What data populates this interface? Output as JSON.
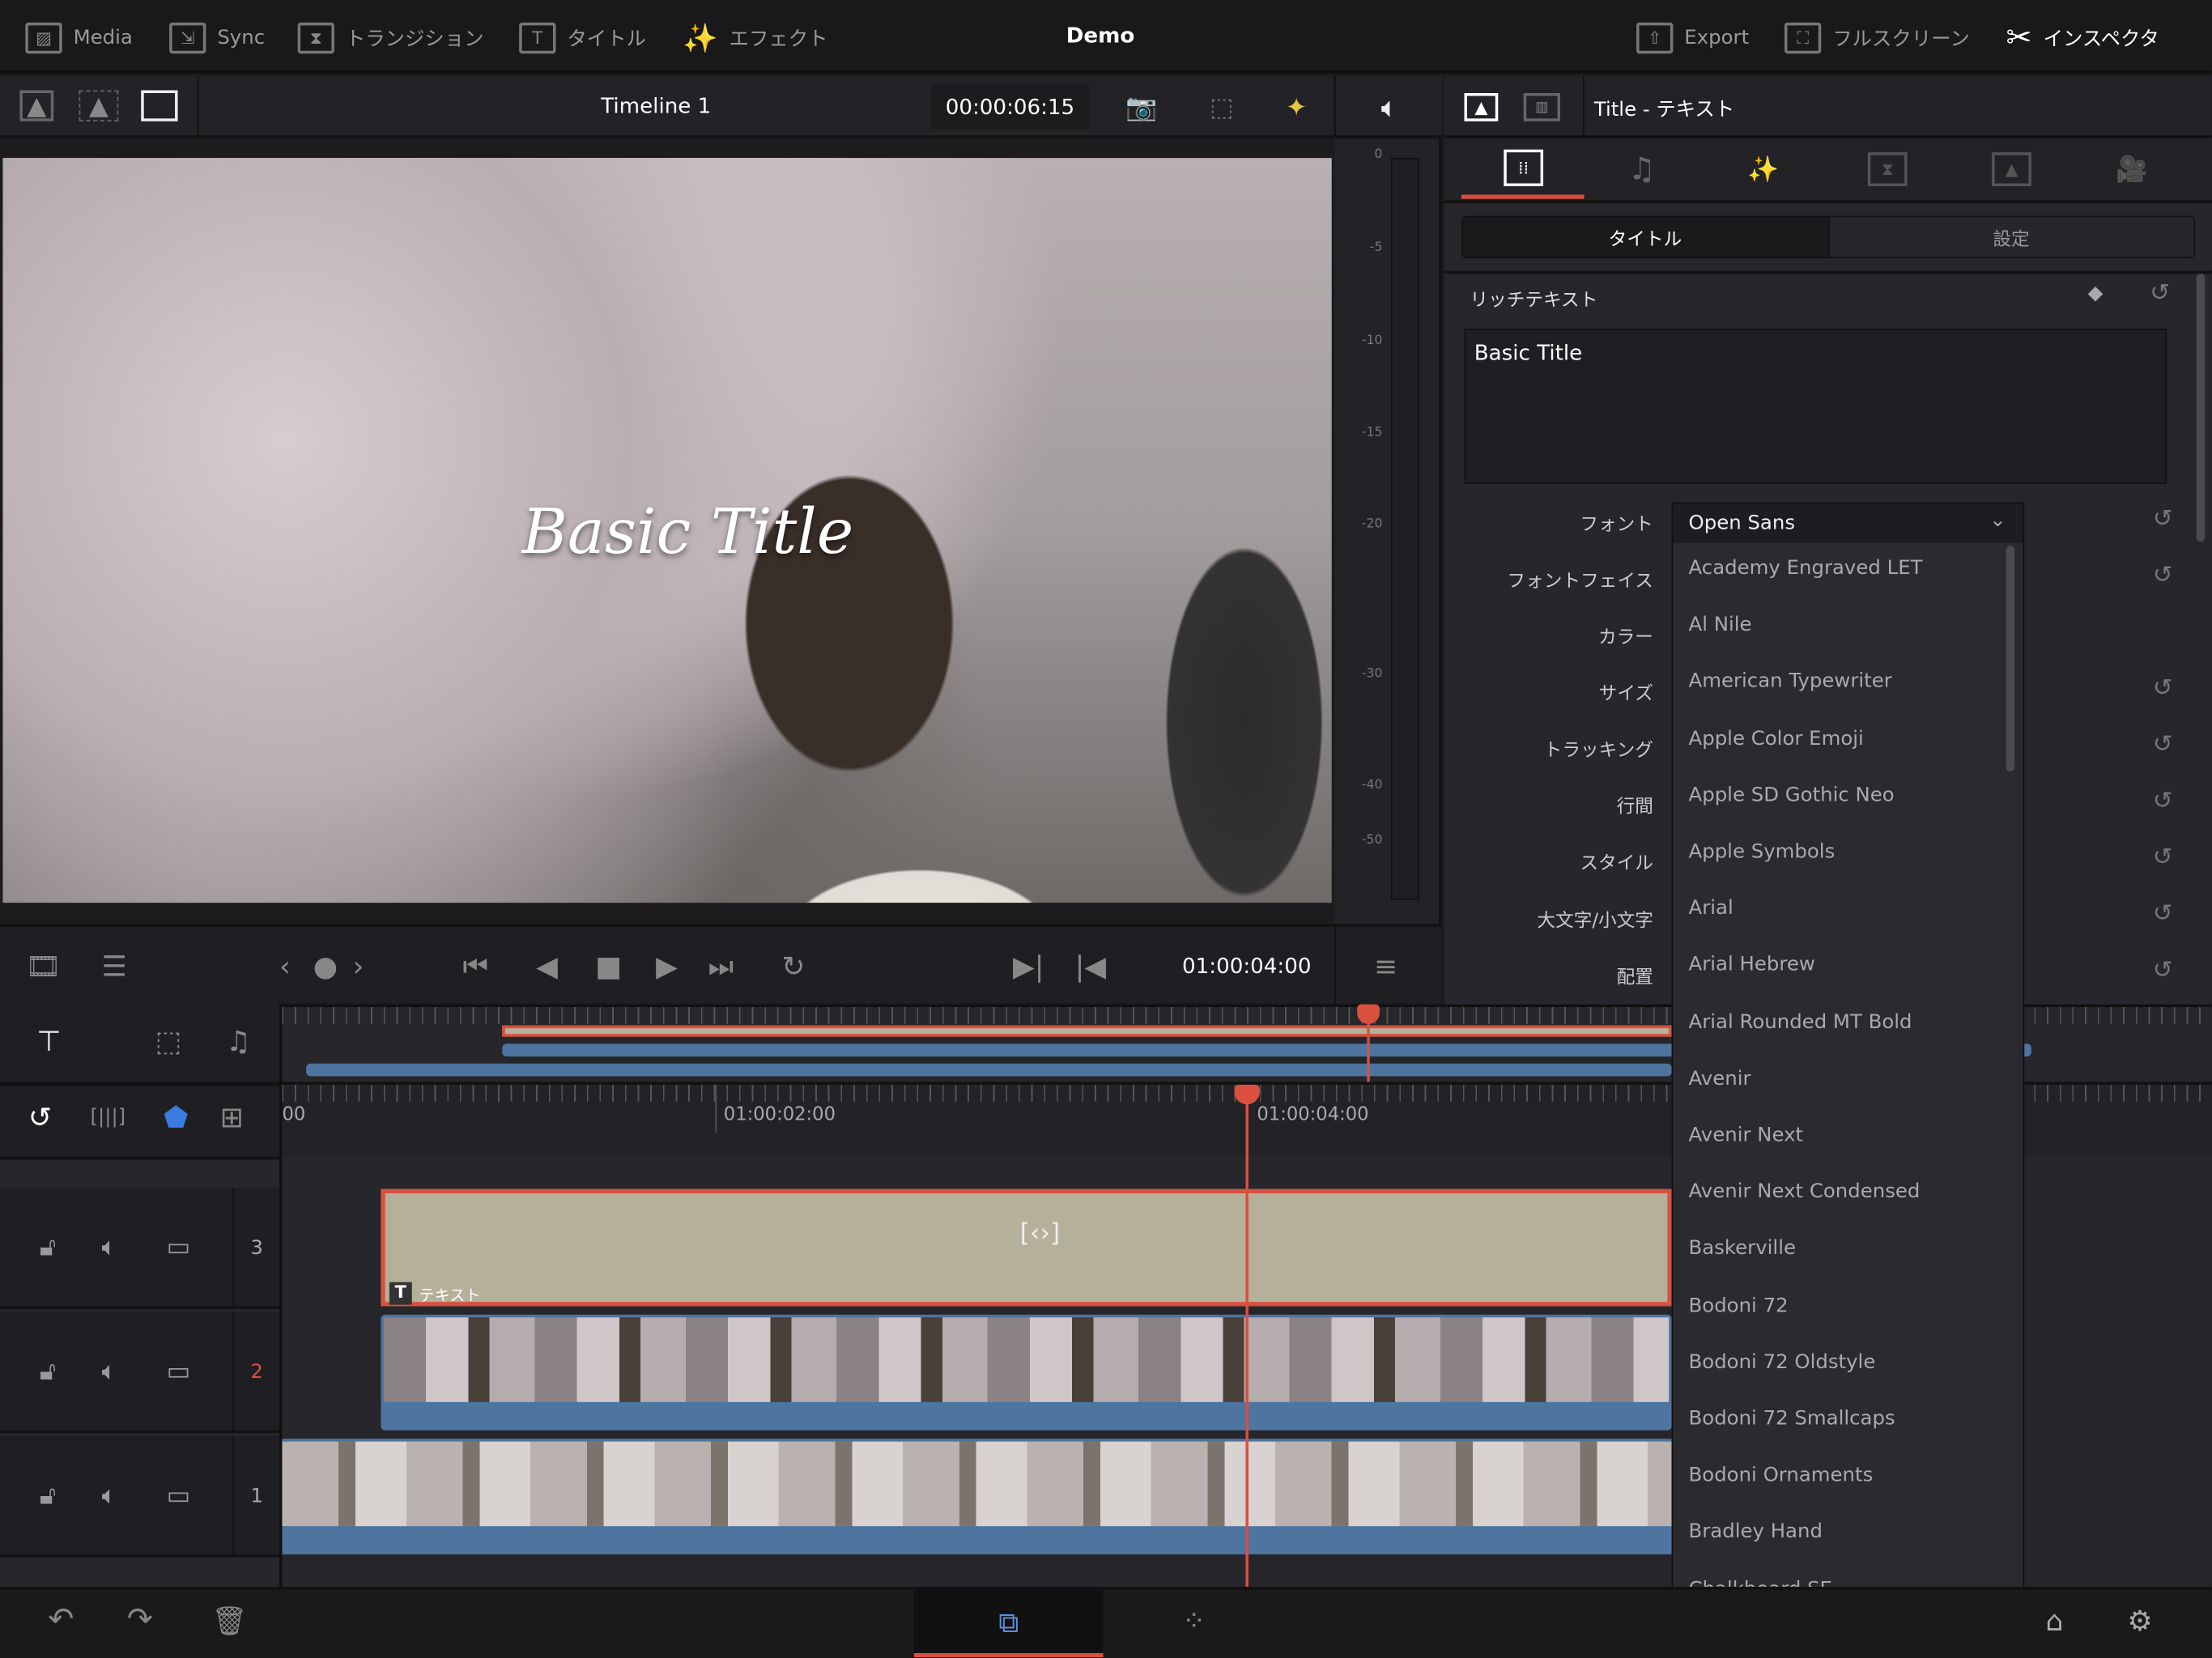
{
  "topbar": {
    "media": "Media",
    "sync": "Sync",
    "transitions": "トランジション",
    "titles": "タイトル",
    "effects": "エフェクト",
    "project": "Demo",
    "export": "Export",
    "fullscreen": "フルスクリーン",
    "inspector": "インスペクタ"
  },
  "viewer_bar": {
    "timeline_name": "Timeline 1",
    "timecode": "00:00:06:15"
  },
  "viewer": {
    "title_overlay": "Basic Title"
  },
  "audio_meter": {
    "labels": [
      "0",
      "-5",
      "-10",
      "-15",
      "-20",
      "-30",
      "-40",
      "-50"
    ]
  },
  "transport": {
    "timecode": "01:00:04:00"
  },
  "inspector": {
    "header_title": "Title - テキスト",
    "segments": [
      "タイトル",
      "設定"
    ],
    "active_segment": 0,
    "rich_text_label": "リッチテキスト",
    "rich_text_value": "Basic Title",
    "properties": [
      "フォント",
      "フォントフェイス",
      "カラー",
      "サイズ",
      "トラッキング",
      "行間",
      "スタイル",
      "大文字/小文字",
      "配置"
    ]
  },
  "font_dropdown": {
    "selected": "Open Sans",
    "options": [
      "Academy Engraved LET",
      "Al Nile",
      "American Typewriter",
      "Apple Color Emoji",
      "Apple SD Gothic Neo",
      "Apple Symbols",
      "Arial",
      "Arial Hebrew",
      "Arial Rounded MT Bold",
      "Avenir",
      "Avenir Next",
      "Avenir Next Condensed",
      "Baskerville",
      "Bodoni 72",
      "Bodoni 72 Oldstyle",
      "Bodoni 72 Smallcaps",
      "Bodoni Ornaments",
      "Bradley Hand",
      "Chalkboard SE"
    ]
  },
  "timeline": {
    "ruler_labels": [
      "00",
      "01:00:02:00",
      "01:00:04:00"
    ],
    "tracks": [
      {
        "number": "3"
      },
      {
        "number": "2"
      },
      {
        "number": "1"
      }
    ],
    "title_clip_label": "テキスト",
    "title_clip_badge": "T"
  },
  "colors": {
    "accent": "#d9503f",
    "audio_clip": "#4e74a0",
    "title_clip": "#b5b09a"
  }
}
